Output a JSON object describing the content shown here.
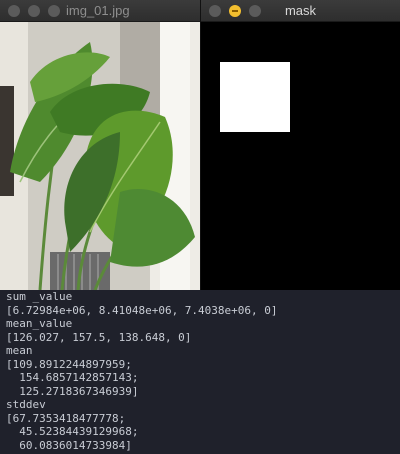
{
  "windows": {
    "image": {
      "title": "img_01.jpg"
    },
    "mask": {
      "title": "mask"
    }
  },
  "icons": {
    "close": "close-icon",
    "minimize": "minimize-icon",
    "zoom": "zoom-icon"
  },
  "colors": {
    "console_bg": "#1f212b",
    "console_text": "#c8ccd4",
    "mask_background": "#000000",
    "mask_region": "#ffffff",
    "minimize_active": "#f3bf2f"
  },
  "console": {
    "lines": [
      "sum _value",
      "[6.72984e+06, 8.41048e+06, 7.4038e+06, 0]",
      "mean_value",
      "[126.027, 157.5, 138.648, 0]",
      "mean",
      "[109.8912244897959;",
      "  154.6857142857143;",
      "  125.2718367346939]",
      "stddev",
      "[67.7353418477778;",
      "  45.52384439129968;",
      "  60.0836014733984]"
    ]
  }
}
